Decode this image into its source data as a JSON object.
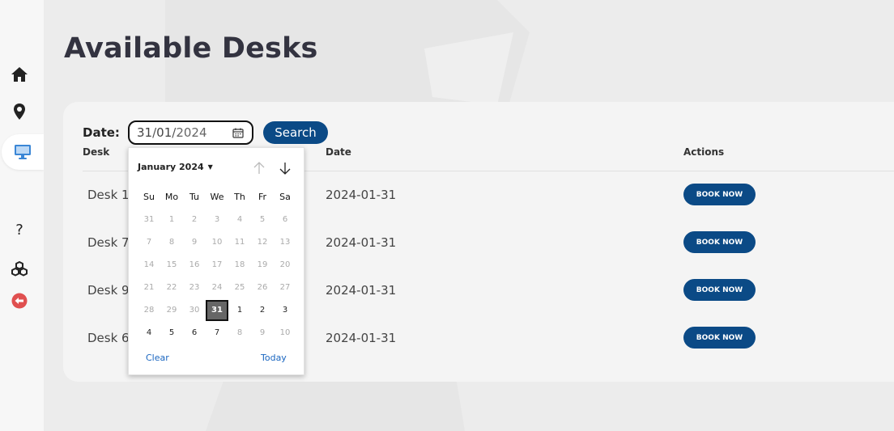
{
  "sidebar": {
    "items": [
      {
        "name": "home",
        "icon": "home-icon"
      },
      {
        "name": "location",
        "icon": "map-pin-icon"
      },
      {
        "name": "desks",
        "icon": "monitor-icon",
        "active": true
      },
      {
        "name": "help",
        "icon": "help-icon",
        "glyph": "?"
      },
      {
        "name": "resources",
        "icon": "cubes-icon"
      },
      {
        "name": "logout",
        "icon": "logout-icon"
      }
    ]
  },
  "page": {
    "title": "Available Desks"
  },
  "search": {
    "date_label": "Date:",
    "date_day": "31",
    "date_month": "01",
    "date_year": "2024",
    "separator": "/",
    "button_label": "Search"
  },
  "table": {
    "headers": [
      "Desk",
      "Date",
      "Actions"
    ],
    "rows": [
      {
        "desk": "Desk 1",
        "date": "2024-01-31",
        "action": "BOOK NOW"
      },
      {
        "desk": "Desk 7",
        "date": "2024-01-31",
        "action": "BOOK NOW"
      },
      {
        "desk": "Desk 9",
        "date": "2024-01-31",
        "action": "BOOK NOW"
      },
      {
        "desk": "Desk 6",
        "date": "2024-01-31",
        "action": "BOOK NOW"
      }
    ]
  },
  "calendar": {
    "month_label": "January 2024",
    "weekdays": [
      "Su",
      "Mo",
      "Tu",
      "We",
      "Th",
      "Fr",
      "Sa"
    ],
    "weeks": [
      [
        [
          "31",
          0
        ],
        [
          "1",
          0
        ],
        [
          "2",
          0
        ],
        [
          "3",
          0
        ],
        [
          "4",
          0
        ],
        [
          "5",
          0
        ],
        [
          "6",
          0
        ]
      ],
      [
        [
          "7",
          0
        ],
        [
          "8",
          0
        ],
        [
          "9",
          0
        ],
        [
          "10",
          0
        ],
        [
          "11",
          0
        ],
        [
          "12",
          0
        ],
        [
          "13",
          0
        ]
      ],
      [
        [
          "14",
          0
        ],
        [
          "15",
          0
        ],
        [
          "16",
          0
        ],
        [
          "17",
          0
        ],
        [
          "18",
          0
        ],
        [
          "19",
          0
        ],
        [
          "20",
          0
        ]
      ],
      [
        [
          "21",
          0
        ],
        [
          "22",
          0
        ],
        [
          "23",
          0
        ],
        [
          "24",
          0
        ],
        [
          "25",
          0
        ],
        [
          "26",
          0
        ],
        [
          "27",
          0
        ]
      ],
      [
        [
          "28",
          0
        ],
        [
          "29",
          0
        ],
        [
          "30",
          0
        ],
        [
          "31",
          2
        ],
        [
          "1",
          1
        ],
        [
          "2",
          1
        ],
        [
          "3",
          1
        ]
      ],
      [
        [
          "4",
          1
        ],
        [
          "5",
          1
        ],
        [
          "6",
          1
        ],
        [
          "7",
          1
        ],
        [
          "8",
          0
        ],
        [
          "9",
          0
        ],
        [
          "10",
          0
        ]
      ]
    ],
    "clear_label": "Clear",
    "today_label": "Today"
  },
  "colors": {
    "accent": "#0b4a86",
    "logout": "#e05050",
    "active_icon": "#3a86d6"
  }
}
